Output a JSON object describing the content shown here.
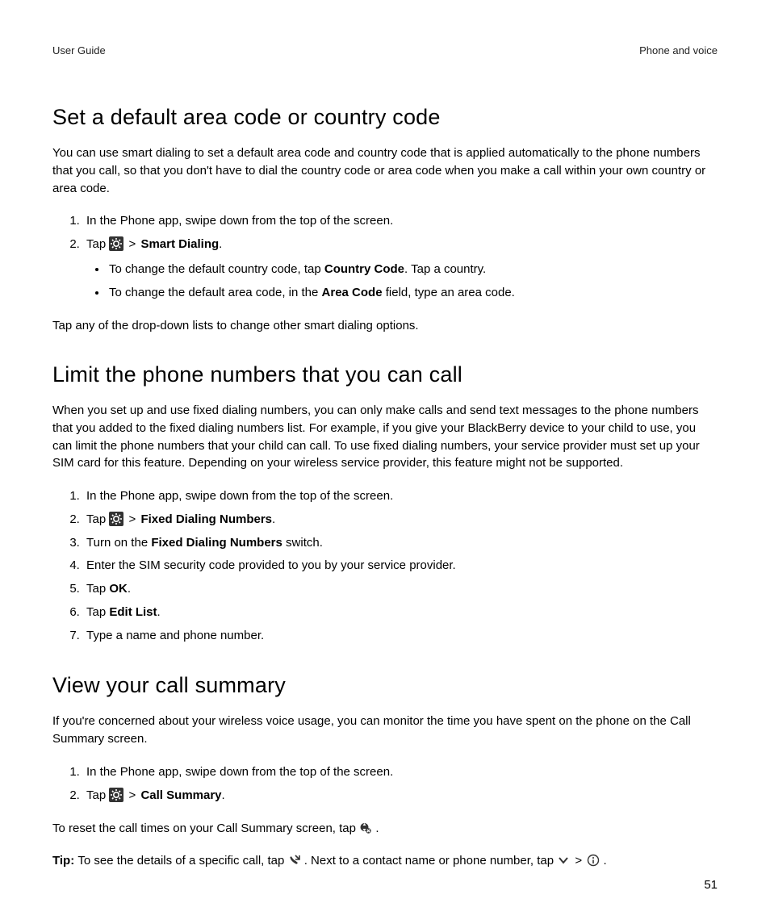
{
  "header": {
    "left": "User Guide",
    "right": "Phone and voice"
  },
  "page_number": "51",
  "sect1": {
    "title": "Set a default area code or country code",
    "intro": "You can use smart dialing to set a default area code and country code that is applied automatically to the phone numbers that you call, so that you don't have to dial the country code or area code when you make a call within your own country or area code.",
    "step1": "In the Phone app, swipe down from the top of the screen.",
    "step2_pre": "Tap ",
    "step2_gt": " > ",
    "step2_bold": "Smart Dialing",
    "step2_post": ".",
    "bullet1_pre": "To change the default country code, tap ",
    "bullet1_bold": "Country Code",
    "bullet1_post": ". Tap a country.",
    "bullet2_pre": "To change the default area code, in the ",
    "bullet2_bold": "Area Code",
    "bullet2_post": " field, type an area code.",
    "outro": "Tap any of the drop-down lists to change other smart dialing options."
  },
  "sect2": {
    "title": "Limit the phone numbers that you can call",
    "intro": "When you set up and use fixed dialing numbers, you can only make calls and send text messages to the phone numbers that you added to the fixed dialing numbers list. For example, if you give your BlackBerry device to your child to use, you can limit the phone numbers that your child can call. To use fixed dialing numbers, your service provider must set up your SIM card for this feature. Depending on your wireless service provider, this feature might not be supported.",
    "step1": "In the Phone app, swipe down from the top of the screen.",
    "step2_pre": "Tap ",
    "step2_gt": " > ",
    "step2_bold": "Fixed Dialing Numbers",
    "step2_post": ".",
    "step3_pre": "Turn on the ",
    "step3_bold": "Fixed Dialing Numbers",
    "step3_post": " switch.",
    "step4": "Enter the SIM security code provided to you by your service provider.",
    "step5_pre": "Tap ",
    "step5_bold": "OK",
    "step5_post": ".",
    "step6_pre": "Tap ",
    "step6_bold": "Edit List",
    "step6_post": ".",
    "step7": "Type a name and phone number."
  },
  "sect3": {
    "title": "View your call summary",
    "intro": "If you're concerned about your wireless voice usage, you can monitor the time you have spent on the phone on the Call Summary screen.",
    "step1": "In the Phone app, swipe down from the top of the screen.",
    "step2_pre": "Tap ",
    "step2_gt": " > ",
    "step2_bold": "Call Summary",
    "step2_post": ".",
    "outro_pre": "To reset the call times on your Call Summary screen, tap ",
    "outro_post": " .",
    "tip_label": "Tip: ",
    "tip_1": "To see the details of a specific call, tap ",
    "tip_2": " . Next to a contact name or phone number, tap ",
    "tip_gt": " > ",
    "tip_end": " ."
  }
}
